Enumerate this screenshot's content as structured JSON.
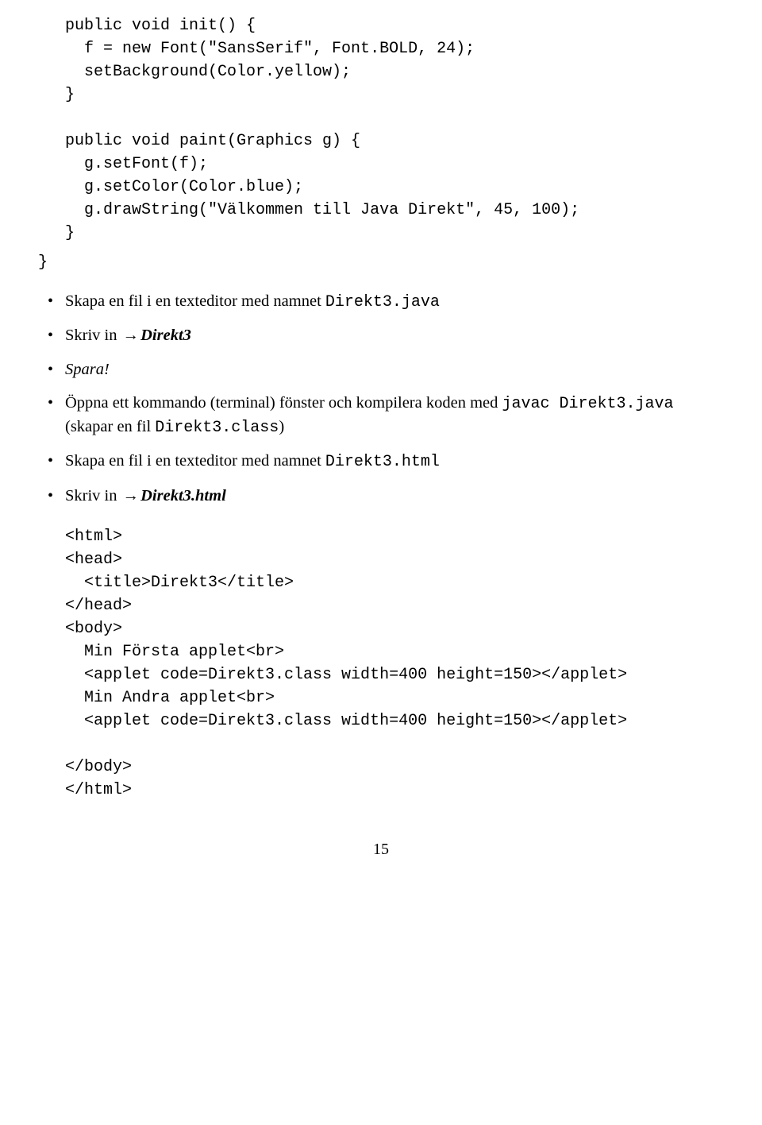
{
  "code_top": "public void init() {\n  f = new Font(\"SansSerif\", Font.BOLD, 24);\n  setBackground(Color.yellow);\n}\n\npublic void paint(Graphics g) {\n  g.setFont(f);\n  g.setColor(Color.blue);\n  g.drawString(\"Välkommen till Java Direkt\", 45, 100);\n}",
  "close_brace": "}",
  "bullets": {
    "b1_a": "Skapa en fil i en texteditor med namnet ",
    "b1_tt": "Direkt3.java",
    "b2_a": "Skriv in ",
    "b2_arrow": "→",
    "b2_sbi": "Direkt3",
    "b3": "Spara!",
    "b4_a": "Öppna ett kommando (terminal) fönster och kompilera koden med ",
    "b4_tt1": "javac Direkt3.java",
    "b4_b": " (skapar en fil ",
    "b4_tt2": "Direkt3.class",
    "b4_c": ")",
    "b5_a": "Skapa en fil i en texteditor med namnet ",
    "b5_tt": "Direkt3.html",
    "b6_a": "Skriv in ",
    "b6_arrow": "→",
    "b6_sbi": "Direkt3.html"
  },
  "html_block": "<html>\n<head>\n  <title>Direkt3</title>\n</head>\n<body>\n  Min Första applet<br>\n  <applet code=Direkt3.class width=400 height=150></applet>\n  Min Andra applet<br>\n  <applet code=Direkt3.class width=400 height=150></applet>\n\n</body>\n</html>",
  "page_number": "15"
}
